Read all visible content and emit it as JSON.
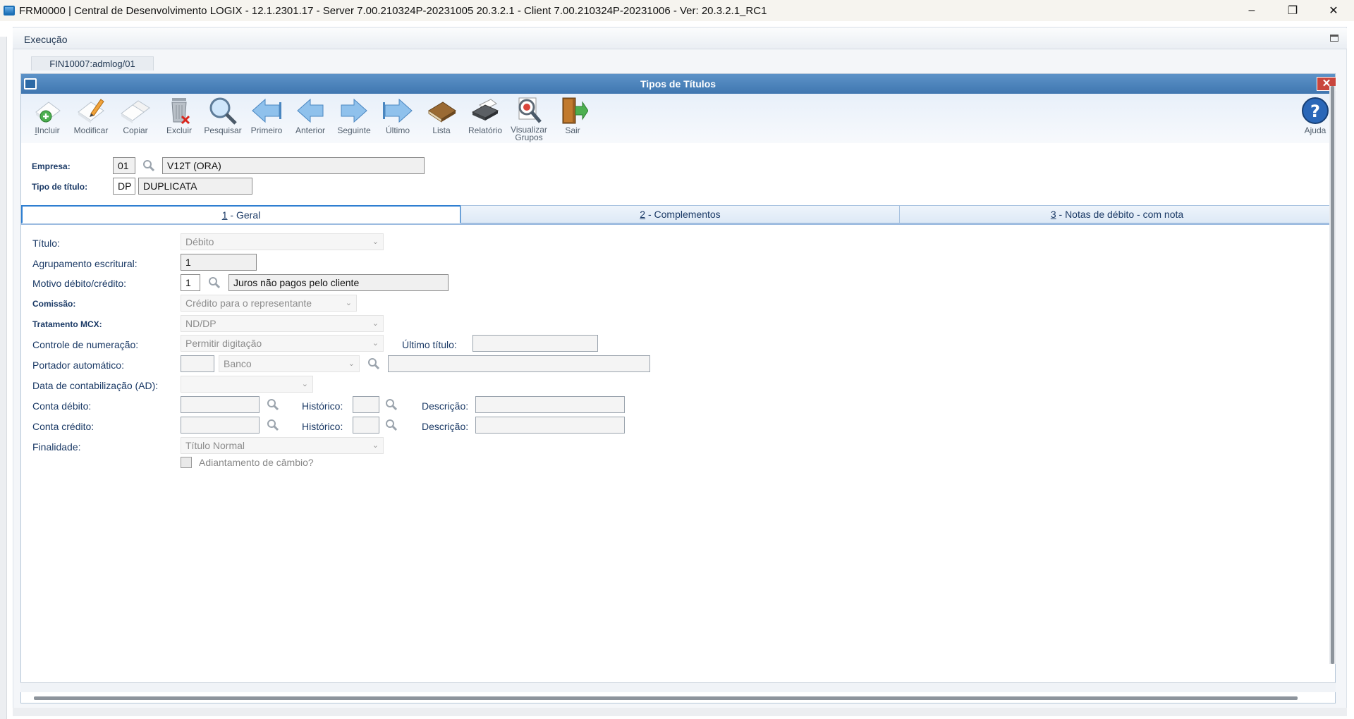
{
  "window": {
    "title": "FRM0000 | Central de Desenvolvimento LOGIX  -  12.1.2301.17 - Server 7.00.210324P-20231005 20.3.2.1 - Client 7.00.210324P-20231006 - Ver: 20.3.2.1_RC1",
    "minimize": "–",
    "restore": "❐",
    "close": "✕"
  },
  "menu": {
    "execucao": "Execução"
  },
  "program_tab": "FIN10007:admlog/01",
  "form": {
    "title": "Tipos de Títulos",
    "close": "✕",
    "toolbar": {
      "incluir": "Incluir",
      "modificar": "Modificar",
      "copiar": "Copiar",
      "excluir": "Excluir",
      "pesquisar": "Pesquisar",
      "primeiro": "Primeiro",
      "anterior": "Anterior",
      "seguinte": "Seguinte",
      "ultimo": "Último",
      "lista": "Lista",
      "relatorio": "Relatório",
      "visualizar": "Visualizar",
      "grupos": "Grupos",
      "sair": "Sair",
      "ajuda": "Ajuda"
    },
    "header": {
      "empresa_label": "Empresa:",
      "empresa_code": "01",
      "empresa_name": "V12T (ORA)",
      "tipo_label": "Tipo de título:",
      "tipo_code": "DP",
      "tipo_name": "DUPLICATA"
    },
    "tabs": {
      "geral_num": "1",
      "geral": " - Geral",
      "complementos_num": "2",
      "complementos": " - Complementos",
      "notas_num": "3",
      "notas": " - Notas de débito - com nota"
    },
    "fields": {
      "titulo_label": "Título:",
      "titulo_value": "Débito",
      "agrupamento_label": "Agrupamento escritural:",
      "agrupamento_value": "1",
      "motivo_label": "Motivo débito/crédito:",
      "motivo_code": "1",
      "motivo_desc": "Juros não pagos pelo cliente",
      "comissao_label": "Comissão:",
      "comissao_value": "Crédito para o representante",
      "tratamento_label": "Tratamento MCX:",
      "tratamento_value": "ND/DP",
      "controle_label": "Controle de numeração:",
      "controle_value": "Permitir digitação",
      "ultimo_label": "Último título:",
      "ultimo_value": "",
      "portador_label": "Portador automático:",
      "portador_code": "",
      "portador_type": "Banco",
      "portador_desc": "",
      "data_label": "Data de contabilização (AD):",
      "data_value": "",
      "conta_debito_label": "Conta débito:",
      "conta_debito_value": "",
      "historico_label": "Histórico:",
      "historico_debito": "",
      "descricao_label": "Descrição:",
      "descricao_debito": "",
      "conta_credito_label": "Conta crédito:",
      "conta_credito_value": "",
      "historico_credito": "",
      "descricao_credito": "",
      "finalidade_label": "Finalidade:",
      "finalidade_value": "Título Normal",
      "adiantamento_label": "Adiantamento de câmbio?"
    }
  }
}
